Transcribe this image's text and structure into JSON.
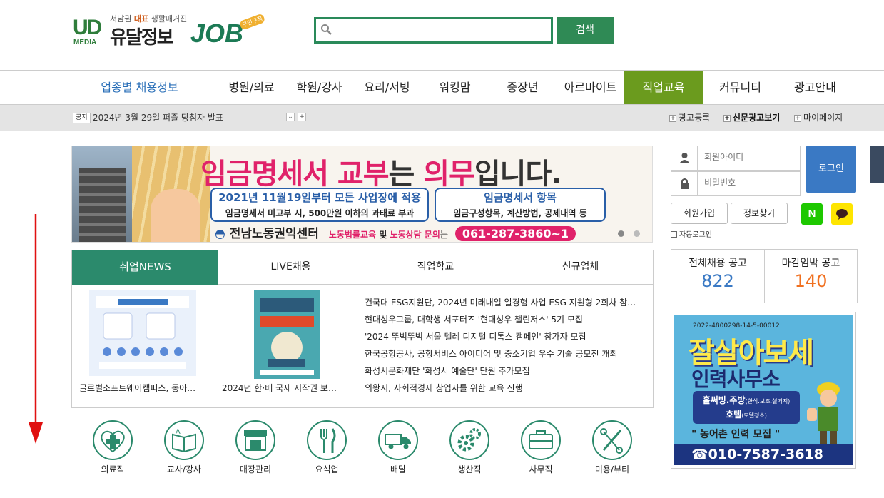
{
  "logo": {
    "mark": "UD",
    "media": "MEDIA",
    "tagline_pre": "서남권 ",
    "tagline_bold": "대표",
    "tagline_post": " 생활매거진",
    "name": "유달정보",
    "job": "JOB",
    "badge": "구인구직"
  },
  "search": {
    "placeholder": "",
    "button": "검색"
  },
  "nav": {
    "items": [
      "업종별 채용정보",
      "병원/의료",
      "학원/강사",
      "요리/서빙",
      "워킹맘",
      "중장년",
      "아르바이트",
      "직업교육",
      "커뮤니티",
      "광고안내"
    ],
    "active_index": 7
  },
  "notice": {
    "tag": "공지",
    "message": "2024년 3월 29일 퍼즐 당첨자 발표",
    "links": [
      "광고등록",
      "신문광고보기",
      "마이페이지"
    ]
  },
  "banner": {
    "headline_pink1": "임금명세서 교부",
    "headline_dark1": "는 ",
    "headline_pink2": "의무",
    "headline_dark2": "입니다.",
    "box1_title": "2021년 11월19일부터 모든 사업장에 적용",
    "box1_sub": "임금명세서 미교부 시, 500만원 이하의 과태료 부과",
    "box2_title": "임금명세서 항목",
    "box2_sub": "임금구성항목, 계산방법, 공제내역 등",
    "org": "전남노동권익센터",
    "service_a": "노동법률교육",
    "service_and": " 및 ",
    "service_b": "노동상담 문의",
    "service_end": "는",
    "phone": "061-287-3860~1"
  },
  "news": {
    "tabs": [
      "취업NEWS",
      "LIVE채용",
      "직업학교",
      "신규업체"
    ],
    "active_tab": 0,
    "thumbs": [
      {
        "caption": "글로벌소프트웨어캠퍼스, 동아…"
      },
      {
        "caption": "2024년 한·베 국제 저작권 보…"
      }
    ],
    "list": [
      "건국대 ESG지원단, 2024년 미래내일 일경험 사업 ESG 지원형 2회차 참…",
      "현대성우그룹, 대학생 서포터즈 '현대성우 챌린저스' 5기 모집",
      "'2024 뚜벅뚜벅 서울 텔레 디지털 디톡스 캠페인' 참가자 모집",
      "한국공항공사, 공항서비스 아이디어 및 중소기업 우수 기술 공모전 개최",
      "화성시문화재단 '화성시 예술단' 단원 추가모집",
      "의왕시, 사회적경제 창업자를 위한 교육 진행"
    ]
  },
  "categories": [
    "의료직",
    "교사/강사",
    "매장관리",
    "요식업",
    "배달",
    "생산직",
    "사무직",
    "미용/뷰티"
  ],
  "login": {
    "id_placeholder": "회원아이디",
    "pw_placeholder": "비밀번호",
    "login_button": "로그인",
    "signup": "회원가입",
    "find": "정보찾기",
    "auto_login": "자동로그인",
    "naver": "N"
  },
  "stats": {
    "total_label": "전체채용 공고",
    "total_value": "822",
    "deadline_label": "마감임박 공고",
    "deadline_value": "140"
  },
  "ad": {
    "reg": "2022-4800298-14-5-00012",
    "big": "잘살아보세",
    "sub": "인력사무소",
    "line1": "홀써빙.주방",
    "line1_small": "(한식.보조.설거지)",
    "line2": "호텔",
    "line2_small": "(모텔청소)",
    "recruit": "\" 농어촌 인력 모집 \"",
    "phone": "☎010-7587-3618"
  },
  "colors": {
    "green": "#2b8a6c",
    "nav_active": "#6b9b1e",
    "blue": "#3a79c4",
    "pink": "#e0226a",
    "orange": "#f07020"
  }
}
